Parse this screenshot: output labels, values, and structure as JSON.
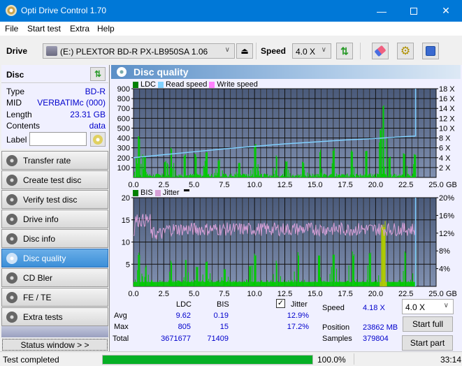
{
  "window": {
    "title": "Opti Drive Control 1.70",
    "controls": [
      "minimize",
      "maximize",
      "close"
    ]
  },
  "menu": [
    {
      "label": "File",
      "accel": "F"
    },
    {
      "label": "Start test",
      "accel": "S"
    },
    {
      "label": "Extra",
      "accel": "x"
    },
    {
      "label": "Help",
      "accel": "H"
    }
  ],
  "toolbar": {
    "drive_label": "Drive",
    "drive_value": "(E:)  PLEXTOR BD-R  PX-LB950SA 1.06",
    "speed_label": "Speed",
    "speed_value": "4.0 X"
  },
  "disc": {
    "header": "Disc",
    "fields": [
      {
        "label": "Type",
        "value": "BD-R"
      },
      {
        "label": "MID",
        "value": "VERBATIMc (000)"
      },
      {
        "label": "Length",
        "value": "23.31 GB"
      },
      {
        "label": "Contents",
        "value": "data"
      }
    ],
    "label_field_label": "Label",
    "label_field_value": ""
  },
  "nav": [
    {
      "label": "Transfer rate",
      "active": false
    },
    {
      "label": "Create test disc",
      "active": false
    },
    {
      "label": "Verify test disc",
      "active": false
    },
    {
      "label": "Drive info",
      "active": false
    },
    {
      "label": "Disc info",
      "active": false
    },
    {
      "label": "Disc quality",
      "active": true
    },
    {
      "label": "CD Bler",
      "active": false
    },
    {
      "label": "FE / TE",
      "active": false
    },
    {
      "label": "Extra tests",
      "active": false
    }
  ],
  "status_window_button": "Status window > >",
  "panel_title": "Disc quality",
  "colors": {
    "ldc": "#008000",
    "read_speed": "#80d0ff",
    "write_speed": "#ff80ff",
    "bis": "#008000",
    "jitter": "#d8a0d8",
    "bars": "#00cc00",
    "plot_bg": "#5a6a8a"
  },
  "chart_data": [
    {
      "type": "bar",
      "title": "LDC / Read speed",
      "legend": [
        "LDC",
        "Read speed",
        "Write speed"
      ],
      "legend_position": "top-left",
      "xlabel": "GB",
      "x_ticks": [
        "0.0",
        "2.5",
        "5.0",
        "7.5",
        "10.0",
        "12.5",
        "15.0",
        "17.5",
        "20.0",
        "22.5",
        "25.0"
      ],
      "xlim": [
        0,
        25
      ],
      "y_ticks_left": [
        "100",
        "200",
        "300",
        "400",
        "500",
        "600",
        "700",
        "800",
        "900"
      ],
      "ylim_left": [
        0,
        900
      ],
      "y_ticks_right": [
        "2 X",
        "4 X",
        "6 X",
        "8 X",
        "10 X",
        "12 X",
        "14 X",
        "16 X",
        "18 X"
      ],
      "ylim_right": [
        0,
        18
      ],
      "grid": true,
      "ldc_peaks": [
        {
          "x": 0.2,
          "y": 220
        },
        {
          "x": 0.4,
          "y": 420
        },
        {
          "x": 0.9,
          "y": 230
        },
        {
          "x": 2.6,
          "y": 170
        },
        {
          "x": 3.1,
          "y": 310
        },
        {
          "x": 4.2,
          "y": 250
        },
        {
          "x": 5.1,
          "y": 240
        },
        {
          "x": 6.0,
          "y": 290
        },
        {
          "x": 7.0,
          "y": 190
        },
        {
          "x": 8.7,
          "y": 160
        },
        {
          "x": 10.0,
          "y": 360
        },
        {
          "x": 11.8,
          "y": 240
        },
        {
          "x": 12.6,
          "y": 180
        },
        {
          "x": 14.0,
          "y": 160
        },
        {
          "x": 15.4,
          "y": 300
        },
        {
          "x": 16.5,
          "y": 300
        },
        {
          "x": 18.0,
          "y": 300
        },
        {
          "x": 19.2,
          "y": 280
        },
        {
          "x": 20.4,
          "y": 560
        },
        {
          "x": 20.6,
          "y": 805
        },
        {
          "x": 21.1,
          "y": 220
        },
        {
          "x": 22.3,
          "y": 250
        },
        {
          "x": 23.2,
          "y": 270
        }
      ],
      "read_speed": [
        {
          "x": 0.0,
          "y": 4.0
        },
        {
          "x": 2.5,
          "y": 4.6
        },
        {
          "x": 5.0,
          "y": 5.2
        },
        {
          "x": 7.5,
          "y": 5.8
        },
        {
          "x": 10.0,
          "y": 6.3
        },
        {
          "x": 12.5,
          "y": 6.8
        },
        {
          "x": 15.0,
          "y": 7.2
        },
        {
          "x": 17.5,
          "y": 7.6
        },
        {
          "x": 20.0,
          "y": 7.9
        },
        {
          "x": 22.5,
          "y": 8.3
        },
        {
          "x": 23.3,
          "y": 8.4
        }
      ]
    },
    {
      "type": "bar",
      "title": "BIS / Jitter",
      "legend": [
        "BIS",
        "Jitter"
      ],
      "legend_position": "top-left",
      "xlabel": "GB",
      "x_ticks": [
        "0.0",
        "2.5",
        "5.0",
        "7.5",
        "10.0",
        "12.5",
        "15.0",
        "17.5",
        "20.0",
        "22.5",
        "25.0"
      ],
      "xlim": [
        0,
        25
      ],
      "y_ticks_left": [
        "5",
        "10",
        "15",
        "20"
      ],
      "ylim_left": [
        0,
        20
      ],
      "y_ticks_right": [
        "4%",
        "8%",
        "12%",
        "16%",
        "20%"
      ],
      "ylim_right": [
        0,
        20
      ],
      "grid": true,
      "bis_peaks": [
        {
          "x": 0.4,
          "y": 8
        },
        {
          "x": 1.0,
          "y": 5
        },
        {
          "x": 3.1,
          "y": 6
        },
        {
          "x": 4.3,
          "y": 6
        },
        {
          "x": 5.2,
          "y": 5
        },
        {
          "x": 6.0,
          "y": 6
        },
        {
          "x": 7.5,
          "y": 4
        },
        {
          "x": 9.6,
          "y": 5
        },
        {
          "x": 10.0,
          "y": 8
        },
        {
          "x": 11.8,
          "y": 6
        },
        {
          "x": 13.6,
          "y": 8
        },
        {
          "x": 15.3,
          "y": 7
        },
        {
          "x": 16.5,
          "y": 8
        },
        {
          "x": 18.1,
          "y": 8
        },
        {
          "x": 19.5,
          "y": 8
        },
        {
          "x": 20.5,
          "y": 15
        },
        {
          "x": 20.7,
          "y": 15
        },
        {
          "x": 22.4,
          "y": 8
        },
        {
          "x": 23.3,
          "y": 10
        }
      ],
      "jitter_avg_percent": 12.9,
      "jitter_max_percent": 17.2
    }
  ],
  "stats": {
    "headers": [
      "LDC",
      "BIS"
    ],
    "jitter_label": "Jitter",
    "jitter_checked": true,
    "rows": [
      {
        "label": "Avg",
        "ldc": "9.62",
        "bis": "0.19",
        "jitter": "12.9%"
      },
      {
        "label": "Max",
        "ldc": "805",
        "bis": "15",
        "jitter": "17.2%"
      },
      {
        "label": "Total",
        "ldc": "3671677",
        "bis": "71409",
        "jitter": ""
      }
    ],
    "speed_label": "Speed",
    "speed_value": "4.18 X",
    "position_label": "Position",
    "position_value": "23862 MB",
    "samples_label": "Samples",
    "samples_value": "379804",
    "speed_select": "4.0 X",
    "start_full": "Start full",
    "start_part": "Start part"
  },
  "statusbar": {
    "text": "Test completed",
    "progress_percent": 100.0,
    "progress_text": "100.0%",
    "time": "33:14"
  }
}
